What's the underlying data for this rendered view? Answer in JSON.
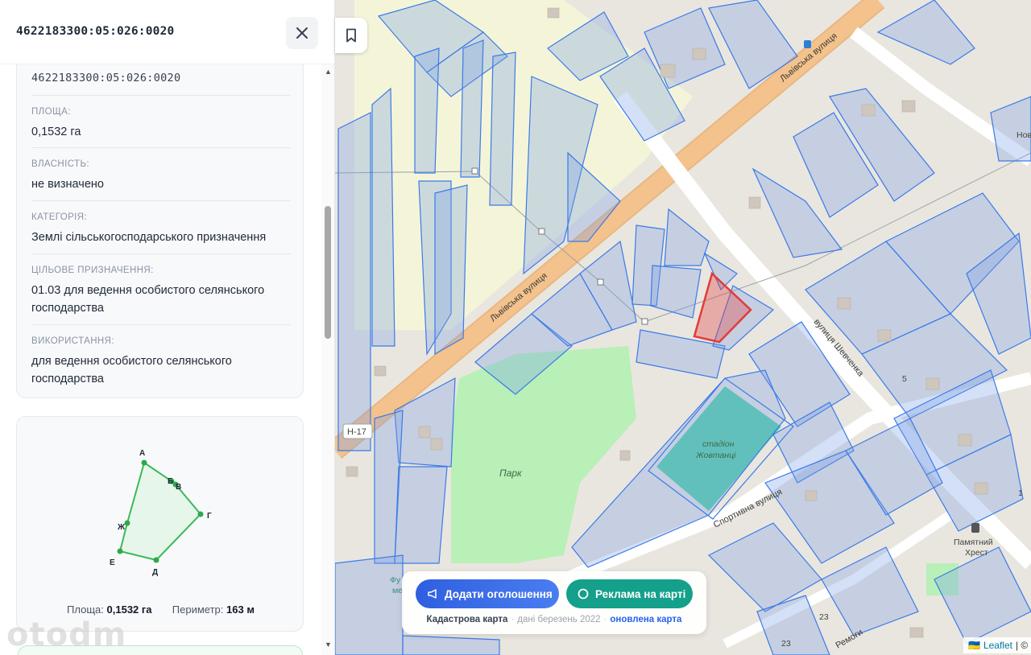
{
  "panel": {
    "title": "4622183300:05:026:0020",
    "cadastral_number": "4622183300:05:026:0020",
    "fields": [
      {
        "label": "Площа:",
        "value": "0,1532 га"
      },
      {
        "label": "Власність:",
        "value": "не визначено"
      },
      {
        "label": "Категорія:",
        "value": "Землі сільськогосподарського призначення"
      },
      {
        "label": "Цільове призначення:",
        "value": "01.03 для ведення особистого селянського господарства"
      },
      {
        "label": "Використання:",
        "value": "для ведення особистого селянського господарства"
      }
    ],
    "shape": {
      "vertex_labels": [
        "А",
        "Б",
        "В",
        "Г",
        "Д",
        "Е",
        "Ж"
      ],
      "area_label": "Площа:",
      "area_value": "0,1532 га",
      "perimeter_label": "Периметр:",
      "perimeter_value": "163 м"
    }
  },
  "map": {
    "street_labels": [
      "Львівська вулиця",
      "Львівська вулиця",
      "вулиця Шевченка",
      "Спортивна вулиця",
      "Ремоги"
    ],
    "road_badge": "Н-17",
    "place_labels": [
      "Парк",
      "стадіон",
      "Жовтанці",
      "Памятний",
      "Хрест",
      "Фу",
      "ме",
      "Нов"
    ],
    "house_numbers": [
      "5",
      "23",
      "23",
      "1"
    ],
    "colors": {
      "parcel": "#5b8def",
      "selected_parcel": "#e23b3b",
      "park": "#b8f0b8",
      "stadium": "#58d0a8",
      "road": "#f4c28c"
    }
  },
  "footer": {
    "add_ad_label": "Додати оголошення",
    "ad_on_map_label": "Реклама на карті",
    "source_name": "Кадастрова карта",
    "source_date": "дані березень 2022",
    "updated_link": "оновлена карта"
  },
  "attribution": {
    "flag": "🇺🇦",
    "leaflet": "Leaflet",
    "rest": "| ©"
  },
  "watermark": "otodm"
}
